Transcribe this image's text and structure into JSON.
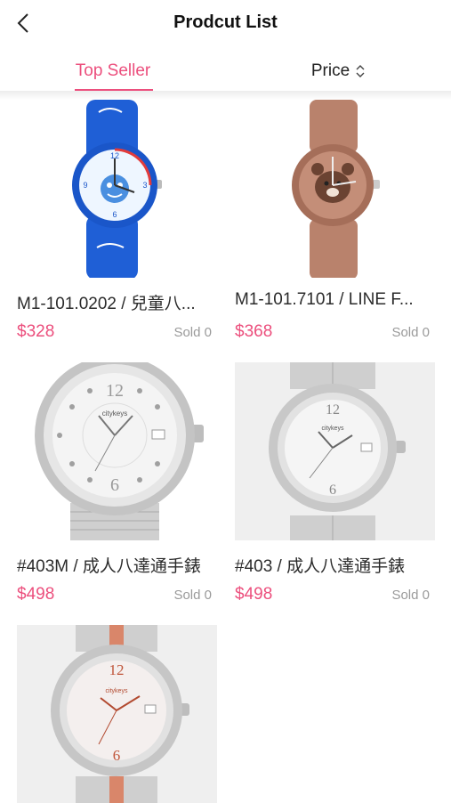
{
  "header": {
    "title": "Prodcut List",
    "back_icon": "chevron-left-icon"
  },
  "tabs": [
    {
      "label": "Top Seller",
      "active": true
    },
    {
      "label": "Price",
      "icon": "sort-updown-icon",
      "active": false
    }
  ],
  "colors": {
    "accent": "#ec4f7d",
    "muted": "#9a9a9a"
  },
  "products": [
    {
      "name": "M1-101.0202 / 兒童八...",
      "price": "$328",
      "sold_label": "Sold",
      "sold_count": "0",
      "image": "blue-shark-kids-watch"
    },
    {
      "name": "M1-101.7101 / LINE F...",
      "price": "$368",
      "sold_label": "Sold",
      "sold_count": "0",
      "image": "brown-bear-watch"
    },
    {
      "name": "#403M / 成人八達通手錶",
      "price": "$498",
      "sold_label": "Sold",
      "sold_count": "0",
      "image": "silver-mesh-watch"
    },
    {
      "name": "#403 / 成人八達通手錶",
      "price": "$498",
      "sold_label": "Sold",
      "sold_count": "0",
      "image": "silver-link-watch"
    },
    {
      "name": "",
      "price": "",
      "sold_label": "",
      "sold_count": "",
      "image": "rose-gold-link-watch"
    }
  ]
}
